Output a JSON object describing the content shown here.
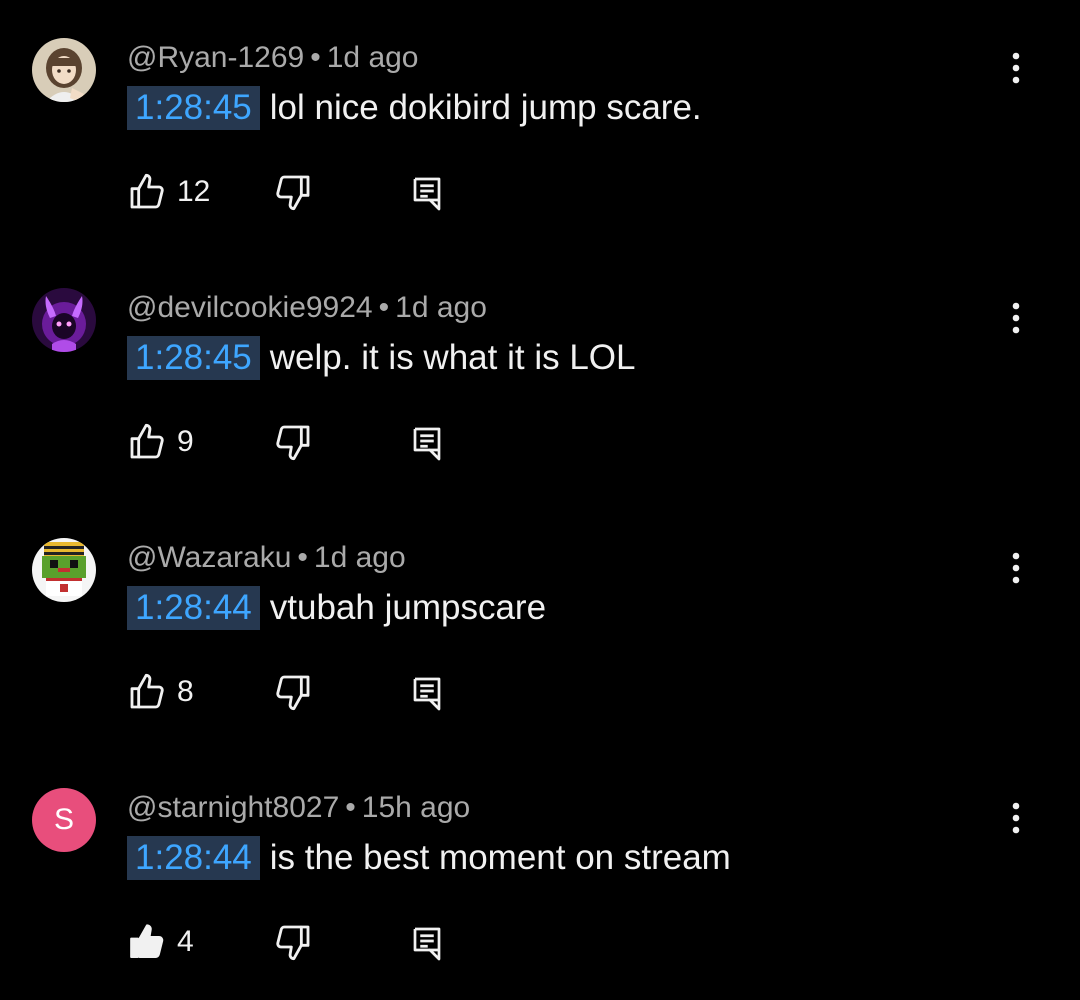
{
  "comments": [
    {
      "handle": "@Ryan-1269",
      "time": "1d ago",
      "timestamp": "1:28:45",
      "text": "lol nice dokibird jump scare.",
      "likes": "12",
      "liked": false,
      "avatar_icon": "anime-girl-avatar"
    },
    {
      "handle": "@devilcookie9924",
      "time": "1d ago",
      "timestamp": "1:28:45",
      "text": "welp. it is what it is LOL",
      "likes": "9",
      "liked": false,
      "avatar_icon": "purple-demon-avatar"
    },
    {
      "handle": "@Wazaraku",
      "time": "1d ago",
      "timestamp": "1:28:44",
      "text": "vtubah jumpscare",
      "likes": "8",
      "liked": false,
      "avatar_icon": "pixel-character-avatar"
    },
    {
      "handle": "@starnight8027",
      "time": "15h ago",
      "timestamp": "1:28:44",
      "text": "is the best moment on stream",
      "likes": "4",
      "liked": true,
      "avatar_letter": "S",
      "avatar_color": "#e84e7c"
    }
  ],
  "separator": "•",
  "colors": {
    "background": "#000000",
    "timestamp_text": "#3ea6ff",
    "timestamp_bg": "#263850",
    "meta_text": "#aaaaaa",
    "body_text": "#f1f1f1"
  }
}
